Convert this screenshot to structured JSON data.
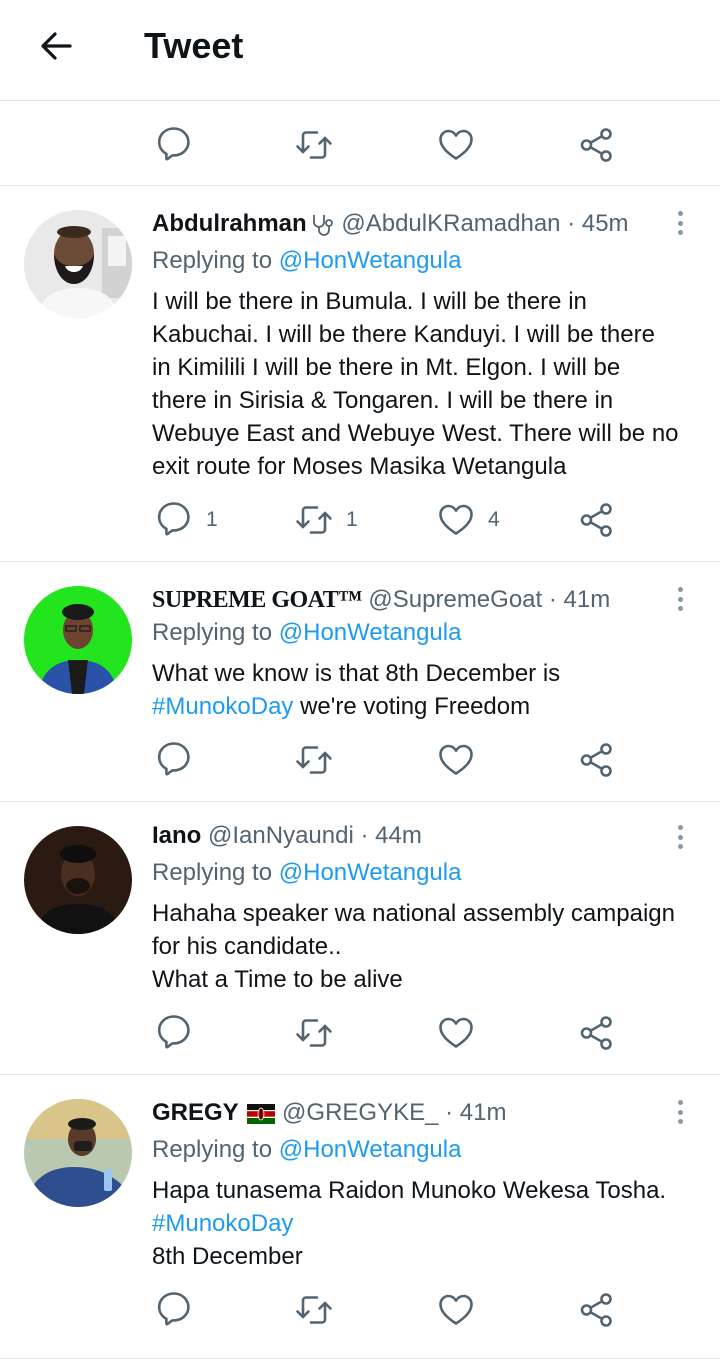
{
  "header": {
    "title": "Tweet"
  },
  "tweets": [
    {
      "name": "Abdulrahman",
      "handle": "@AbdulKRamadhan",
      "sep": " · ",
      "time": "45m",
      "replying_prefix": "Replying to ",
      "replying_to": "@HonWetangula",
      "lines": [
        "I will be there in Bumula. I will be there in",
        "Kabuchai. I will be there Kanduyi. I will be there",
        "in Kimilili I will be there in Mt. Elgon. I will be",
        "there in Sirisia & Tongaren. I will be there in",
        "Webuye East and Webuye West. There will be no",
        "exit route for Moses Masika Wetangula"
      ],
      "reply_count": "1",
      "retweet_count": "1",
      "like_count": "4"
    },
    {
      "name": "SUPREME GOAT™",
      "handle": "@SupremeGoat",
      "sep": " · ",
      "time": "41m",
      "replying_prefix": "Replying to ",
      "replying_to": "@HonWetangula",
      "line1": "What we know is that 8th December is",
      "hashtag": "#MunokoDay",
      "line2_rest": " we're voting Freedom"
    },
    {
      "name": "Iano",
      "handle": "@IanNyaundi",
      "sep": " · ",
      "time": "44m",
      "replying_prefix": "Replying to ",
      "replying_to": "@HonWetangula",
      "lines": [
        "Hahaha speaker wa national assembly campaign",
        "for his candidate..",
        "What a Time to be alive"
      ]
    },
    {
      "name": "GREGY",
      "handle": "@GREGYKE_",
      "sep": " · ",
      "time": "41m",
      "replying_prefix": "Replying to ",
      "replying_to": "@HonWetangula",
      "line1": "Hapa tunasema Raidon Munoko Wekesa Tosha.",
      "hashtag": "#MunokoDay",
      "line3": "8th December"
    }
  ],
  "icons": {
    "back": "arrow-left-icon",
    "reply": "speech-bubble-icon",
    "retweet": "retweet-arrows-icon",
    "like": "heart-icon",
    "share": "share-nodes-icon",
    "more": "vertical-dots-icon",
    "badge_tweet1": "stethoscope-icon",
    "flag_tweet4": "kenya-flag-icon"
  },
  "colors": {
    "link": "#1d9bf0",
    "secondary": "#536471",
    "divider": "#e4e6e8"
  }
}
